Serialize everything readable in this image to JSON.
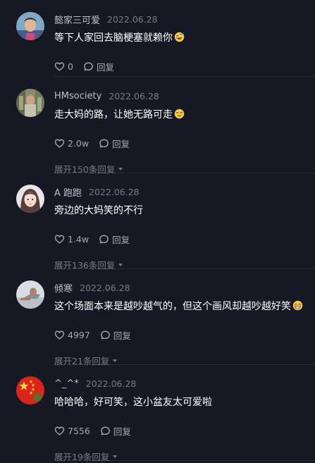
{
  "reply_label": "回复",
  "comments": [
    {
      "username": "懿家三可爱",
      "date": "2022.06.28",
      "text": "等下人家回去脑梗塞就赖你",
      "emoji": "rofl-emoji",
      "likes": "0",
      "expand": ""
    },
    {
      "username": "HMsociety",
      "date": "2022.06.28",
      "text": "走大妈的路，让她无路可走",
      "emoji": "relieved-emoji",
      "likes": "2.0w",
      "expand": "展开150条回复"
    },
    {
      "username": "A 跑跑",
      "date": "2022.06.28",
      "text": "旁边的大妈笑的不行",
      "emoji": "",
      "likes": "1.4w",
      "expand": "展开136条回复"
    },
    {
      "username": "倾寒",
      "date": "2022.06.28",
      "text": "这个场面本来是越吵越气的，但这个画风却越吵越好笑",
      "emoji": "grin-emoji",
      "likes": "4997",
      "expand": "展开21条回复"
    },
    {
      "username": "^_^*",
      "date": "2022.06.28",
      "text": "哈哈哈，好可笑，这小盆友太可爱啦",
      "emoji": "",
      "likes": "7556",
      "expand": "展开19条回复"
    }
  ]
}
